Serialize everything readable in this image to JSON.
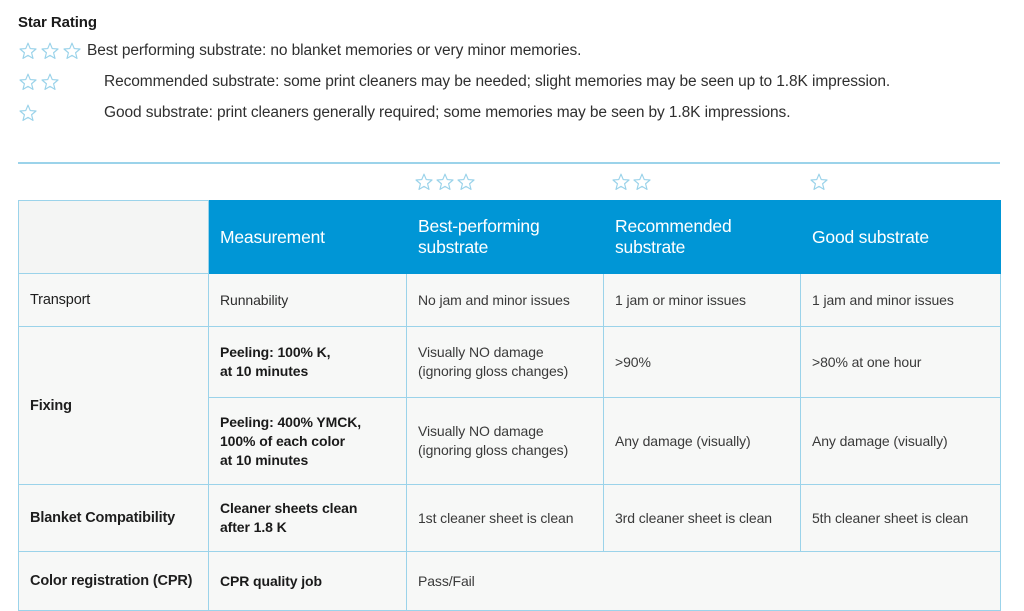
{
  "colors": {
    "header_blue": "#0096D6",
    "rule_blue": "#9BD3EA",
    "star_outline": "#9BD3EA",
    "cell_bg": "#F7F8F7",
    "text": "#2E2E2E"
  },
  "legend": {
    "title": "Star Rating",
    "items": [
      {
        "stars": 3,
        "text": "Best performing substrate: no blanket memories or very minor memories."
      },
      {
        "stars": 2,
        "text": "Recommended substrate: some print cleaners may be needed; slight memories may be seen up to 1.8K impression."
      },
      {
        "stars": 1,
        "text": "Good substrate: print cleaners generally required; some memories may be seen by 1.8K impressions."
      }
    ]
  },
  "table": {
    "star_strip": [
      {
        "column": "best-performing",
        "stars": 3
      },
      {
        "column": "recommended",
        "stars": 2
      },
      {
        "column": "good",
        "stars": 1
      }
    ],
    "headers": {
      "blank": "",
      "measurement": "Measurement",
      "best_performing": "Best-performing substrate",
      "recommended": "Recommended substrate",
      "good": "Good substrate"
    },
    "rows": [
      {
        "label": "Transport",
        "label_bold": false,
        "measurement": "Runnability",
        "measurement_bold": false,
        "best": "No jam and minor issues",
        "recommended": "1 jam or minor issues",
        "good": "1 jam and minor issues"
      },
      {
        "label": "Fixing",
        "label_bold": true,
        "measurement": "Peeling: 100% K,\nat 10 minutes",
        "measurement_bold": true,
        "best": "Visually NO damage\n(ignoring gloss changes)",
        "recommended": ">90%",
        "good": ">80% at one hour"
      },
      {
        "label": "",
        "label_bold": true,
        "measurement": "Peeling: 400% YMCK,\n100% of each color\nat 10 minutes",
        "measurement_bold": true,
        "best": "Visually NO damage\n(ignoring gloss changes)",
        "recommended": "Any damage (visually)",
        "good": "Any damage (visually)"
      },
      {
        "label": "Blanket Compatibility",
        "label_bold": true,
        "measurement": "Cleaner sheets clean\nafter 1.8 K",
        "measurement_bold": true,
        "best": "1st cleaner sheet is clean",
        "recommended": "3rd cleaner sheet is clean",
        "good": "5th cleaner sheet is clean"
      },
      {
        "label": "Color registration (CPR)",
        "label_bold": true,
        "measurement": "CPR quality job",
        "measurement_bold": true,
        "merged_value": "Pass/Fail"
      }
    ]
  }
}
